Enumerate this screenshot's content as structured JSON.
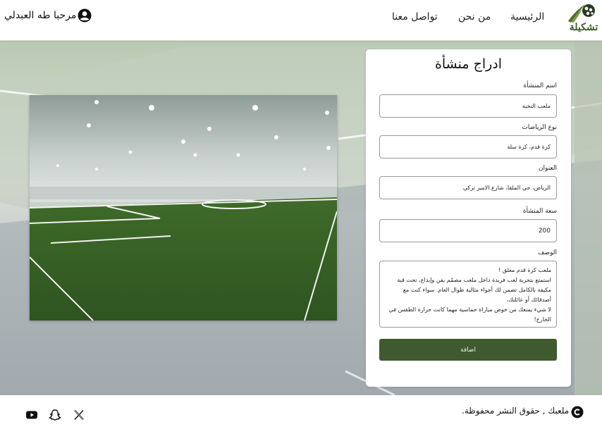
{
  "header": {
    "logo_text": "تشكيلة",
    "nav": {
      "home": "الرئيسية",
      "about": "من نحن",
      "contact": "تواصل معنا"
    },
    "greeting": "مرحبا طه العبدلي"
  },
  "form": {
    "title": "ادراج منشأة",
    "fields": [
      {
        "label": "اسم المنشأة",
        "value": "ملعب النخبه"
      },
      {
        "label": "نوع الرياضات",
        "value": "كرة قدم، كرة سلة"
      },
      {
        "label": "العنوان",
        "value": "الرياض، حي الملقا، شارع الامير تركي"
      },
      {
        "label": "سعة المنشأة",
        "value": "200"
      }
    ],
    "description_label": "الوصف",
    "description_value": "ملعب كرة قدم مغلق !\nاستمتع بتجربة لعب فريدة داخل ملعب مصمّم بفن وإبداع، تحت قبة مكيفة بالكامل تضمن لك أجواء مثالية طوال العام. سواء كنت مع أصدقائك أو عائلتك،\nلا شيء يمنعك من خوض مباراة حماسية مهما كانت حرارة الطقس في الخارج!",
    "submit_label": "اضافة"
  },
  "footer": {
    "copyright": "ملعبك , حقوق النشر محفوظة.",
    "social_icons": [
      "youtube-icon",
      "snapchat-icon",
      "x-icon"
    ]
  },
  "colors": {
    "brand_green": "#3e5a2e",
    "logo_green": "#3c5a2b"
  }
}
